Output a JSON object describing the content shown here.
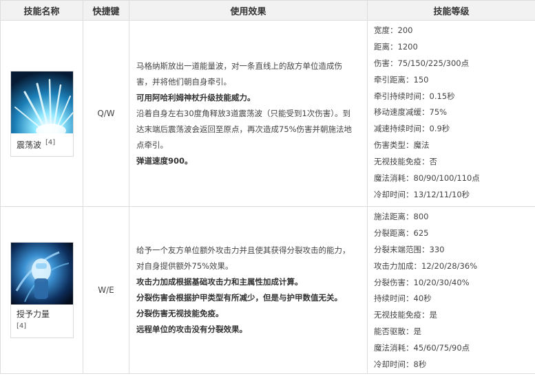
{
  "headers": {
    "name": "技能名称",
    "hotkey": "快捷键",
    "effect": "使用效果",
    "levels": "技能等级"
  },
  "skills": [
    {
      "name": "震荡波",
      "ref": "[4]",
      "icon": "shockwave-icon",
      "hotkey": "Q/W",
      "effect": [
        {
          "text": "马格纳斯放出一道能量波，对一条直线上的敌方单位造成伤害，并将他们朝自身牵引。",
          "bold": false
        },
        {
          "text": "可用阿哈利姆神杖升级技能威力。",
          "bold": true
        },
        {
          "text": "沿着自身左右30度角释放3道震荡波（只能受到1次伤害）。到达末端后震荡波会返回至原点，再次造成75%伤害并朝施法地点牵引。",
          "bold": false
        },
        {
          "text": "弹道速度900。",
          "bold": true
        }
      ],
      "levels": [
        "宽度：200",
        "距离：1200",
        "伤害：75/150/225/300点",
        "牵引距离：150",
        "牵引持续时间：0.15秒",
        "移动速度减缓：75%",
        "减速持续时间：0.9秒",
        "伤害类型：魔法",
        "无视技能免疫：否",
        "魔法消耗：80/90/100/110点",
        "冷却时间：13/12/11/10秒"
      ]
    },
    {
      "name": "授予力量",
      "ref": "[4]",
      "icon": "empower-icon",
      "hotkey": "W/E",
      "effect": [
        {
          "text": "给予一个友方单位额外攻击力并且使其获得分裂攻击的能力，对自身提供额外75%效果。",
          "bold": false
        },
        {
          "text": "攻击力加成根据基础攻击力和主属性加成计算。",
          "bold": true
        },
        {
          "text": "分裂伤害会根据护甲类型有所减少，但是与护甲数值无关。",
          "bold": true
        },
        {
          "text": "分裂伤害无视技能免疫。",
          "bold": true
        },
        {
          "text": "远程单位的攻击没有分裂效果。",
          "bold": true
        }
      ],
      "levels": [
        "施法距离：800",
        "分裂距离：625",
        "分裂末端范围：330",
        "攻击力加成：12/20/28/36%",
        "分裂伤害：10/20/30/40%",
        "持续时间：40秒",
        "无视技能免疫：是",
        "能否驱散：是",
        "魔法消耗：45/60/75/90点",
        "冷却时间：8秒"
      ]
    }
  ]
}
